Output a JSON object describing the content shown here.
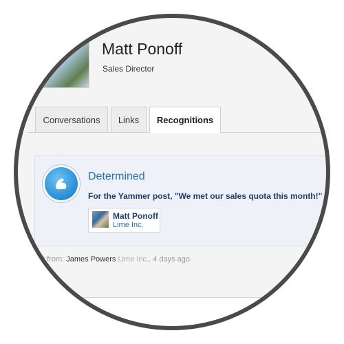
{
  "profile": {
    "name": "Matt Ponoff",
    "title": "Sales Director"
  },
  "tabs": [
    {
      "label": "Conversations",
      "active": false
    },
    {
      "label": "Links",
      "active": false
    },
    {
      "label": "Recognitions",
      "active": true
    }
  ],
  "recognition": {
    "badge_icon": "flexed-arm-icon",
    "title": "Determined",
    "text": "For the Yammer post, \"We met our sales quota this month!\"",
    "person": {
      "name": "Matt Ponoff",
      "company": "Lime Inc."
    },
    "footer": {
      "prefix": "t from:",
      "from_name": "James Powers",
      "from_company": "Lime Inc.,",
      "time": "4 days ago."
    }
  },
  "colors": {
    "accent": "#1e73be",
    "card_bg": "#eef2f8",
    "ring": "#4a4a4a"
  }
}
